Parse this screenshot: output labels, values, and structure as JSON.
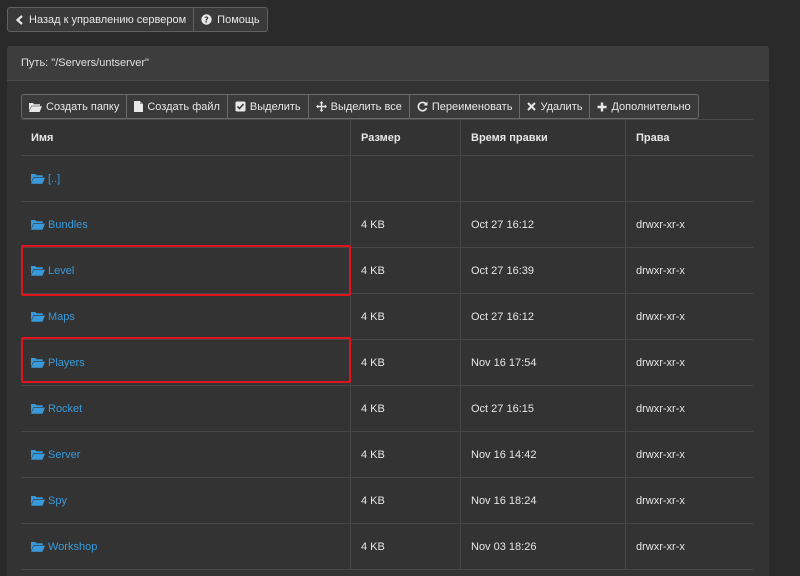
{
  "topbar": {
    "back_label": "Назад к управлению сервером",
    "help_label": "Помощь"
  },
  "path": "Путь: \"/Servers/untserver\"",
  "toolbar": {
    "create_folder": "Создать папку",
    "create_file": "Создать файл",
    "select": "Выделить",
    "select_all": "Выделить все",
    "rename": "Переименовать",
    "delete": "Удалить",
    "more": "Дополнительно"
  },
  "table": {
    "headers": {
      "name": "Имя",
      "size": "Размер",
      "modified": "Время правки",
      "perms": "Права"
    },
    "rows": [
      {
        "name": "[..]",
        "size": "",
        "modified": "",
        "perms": ""
      },
      {
        "name": "Bundles",
        "size": "4 KB",
        "modified": "Oct 27 16:12",
        "perms": "drwxr-xr-x"
      },
      {
        "name": "Level",
        "size": "4 KB",
        "modified": "Oct 27 16:39",
        "perms": "drwxr-xr-x"
      },
      {
        "name": "Maps",
        "size": "4 KB",
        "modified": "Oct 27 16:12",
        "perms": "drwxr-xr-x"
      },
      {
        "name": "Players",
        "size": "4 KB",
        "modified": "Nov 16 17:54",
        "perms": "drwxr-xr-x"
      },
      {
        "name": "Rocket",
        "size": "4 KB",
        "modified": "Oct 27 16:15",
        "perms": "drwxr-xr-x"
      },
      {
        "name": "Server",
        "size": "4 KB",
        "modified": "Nov 16 14:42",
        "perms": "drwxr-xr-x"
      },
      {
        "name": "Spy",
        "size": "4 KB",
        "modified": "Nov 16 18:24",
        "perms": "drwxr-xr-x"
      },
      {
        "name": "Workshop",
        "size": "4 KB",
        "modified": "Nov 03 18:26",
        "perms": "drwxr-xr-x"
      }
    ]
  },
  "colors": {
    "link": "#3a9ad9",
    "highlight": "#e0121b",
    "panel": "#333333"
  },
  "icons": [
    "chevron-left-icon",
    "question-circle-icon",
    "folder-open-icon",
    "file-icon",
    "check-square-icon",
    "move-icon",
    "refresh-icon",
    "close-icon",
    "plus-icon"
  ]
}
